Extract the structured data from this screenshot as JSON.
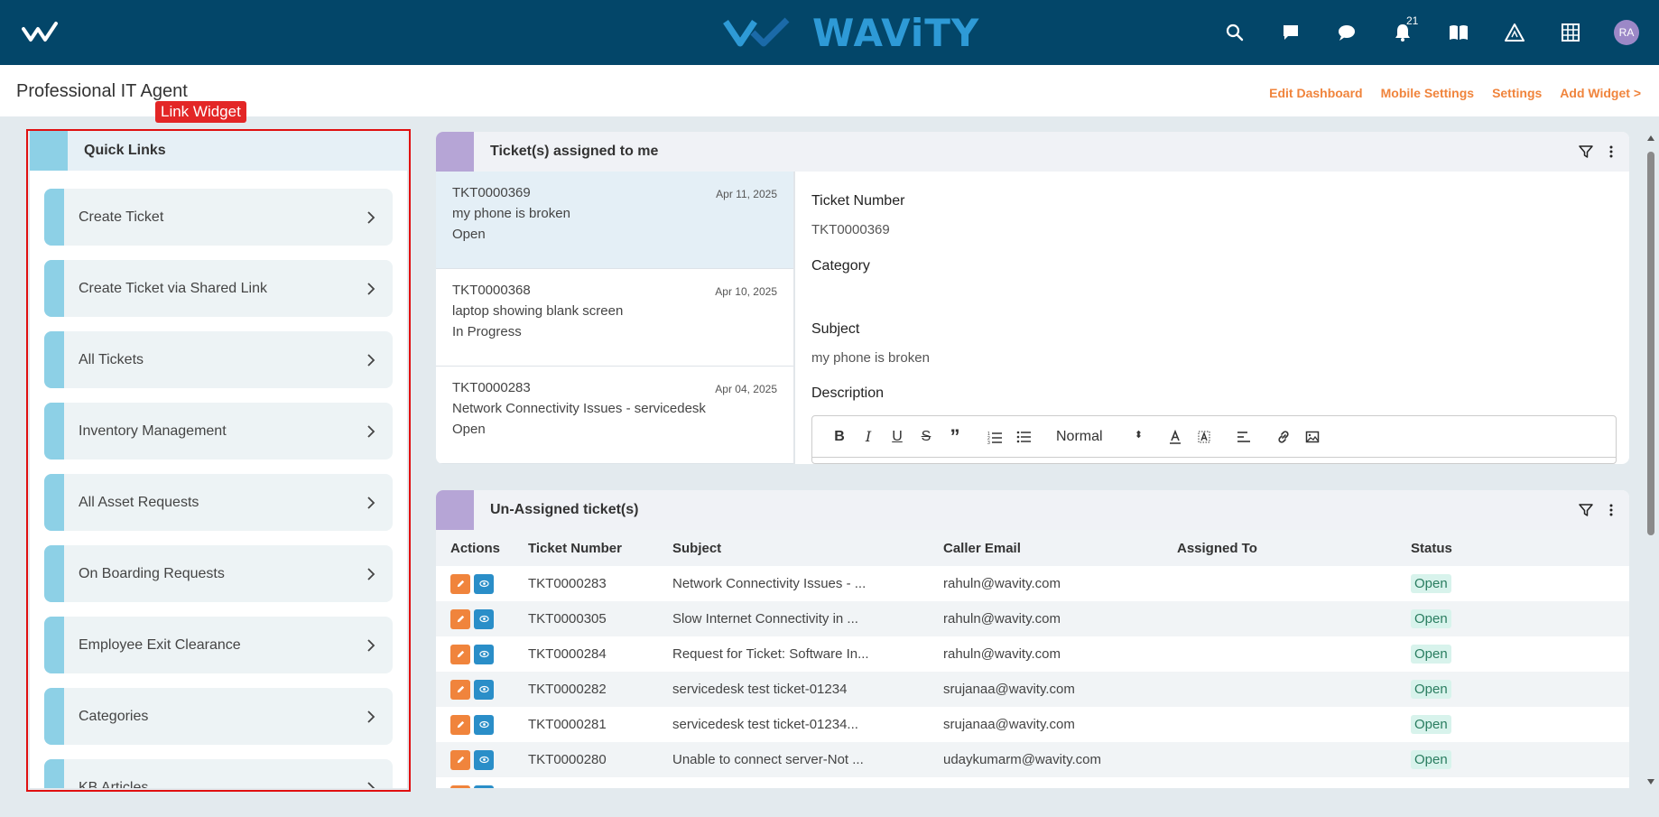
{
  "brand": {
    "name": "WAViTY"
  },
  "nav": {
    "notification_count": "21",
    "avatar_initials": "RA"
  },
  "header": {
    "title": "Professional IT Agent",
    "links": [
      "Edit Dashboard",
      "Mobile Settings",
      "Settings",
      "Add Widget >"
    ]
  },
  "annotation": {
    "label": "Link Widget"
  },
  "quick_links": {
    "title": "Quick Links",
    "items": [
      "Create Ticket",
      "Create Ticket via Shared Link",
      "All Tickets",
      "Inventory Management",
      "All Asset Requests",
      "On Boarding Requests",
      "Employee Exit Clearance",
      "Categories",
      "KB Articles"
    ]
  },
  "assigned": {
    "title": "Ticket(s) assigned to me",
    "tickets": [
      {
        "number": "TKT0000369",
        "subject": "my phone is broken",
        "status": "Open",
        "date": "Apr 11, 2025"
      },
      {
        "number": "TKT0000368",
        "subject": "laptop showing blank screen",
        "status": "In Progress",
        "date": "Apr 10, 2025"
      },
      {
        "number": "TKT0000283",
        "subject": "Network Connectivity Issues - servicedesk",
        "status": "Open",
        "date": "Apr 04, 2025"
      }
    ],
    "detail": {
      "ticket_number_label": "Ticket Number",
      "ticket_number": "TKT0000369",
      "category_label": "Category",
      "subject_label": "Subject",
      "subject": "my phone is broken",
      "description_label": "Description",
      "editor_format": "Normal"
    }
  },
  "unassigned": {
    "title": "Un-Assigned ticket(s)",
    "columns": [
      "Actions",
      "Ticket Number",
      "Subject",
      "Caller Email",
      "Assigned To",
      "Status"
    ],
    "rows": [
      {
        "number": "TKT0000283",
        "subject": "Network Connectivity Issues - ...",
        "email": "rahuln@wavity.com",
        "assigned": "",
        "status": "Open"
      },
      {
        "number": "TKT0000305",
        "subject": "Slow Internet Connectivity in ...",
        "email": "rahuln@wavity.com",
        "assigned": "",
        "status": "Open"
      },
      {
        "number": "TKT0000284",
        "subject": "Request for Ticket: Software In...",
        "email": "rahuln@wavity.com",
        "assigned": "",
        "status": "Open"
      },
      {
        "number": "TKT0000282",
        "subject": "servicedesk test ticket-01234",
        "email": "srujanaa@wavity.com",
        "assigned": "",
        "status": "Open"
      },
      {
        "number": "TKT0000281",
        "subject": "servicedesk test ticket-01234...",
        "email": "srujanaa@wavity.com",
        "assigned": "",
        "status": "Open"
      },
      {
        "number": "TKT0000280",
        "subject": "Unable to connect server-Not ...",
        "email": "udaykumarm@wavity.com",
        "assigned": "",
        "status": "Open"
      }
    ]
  }
}
